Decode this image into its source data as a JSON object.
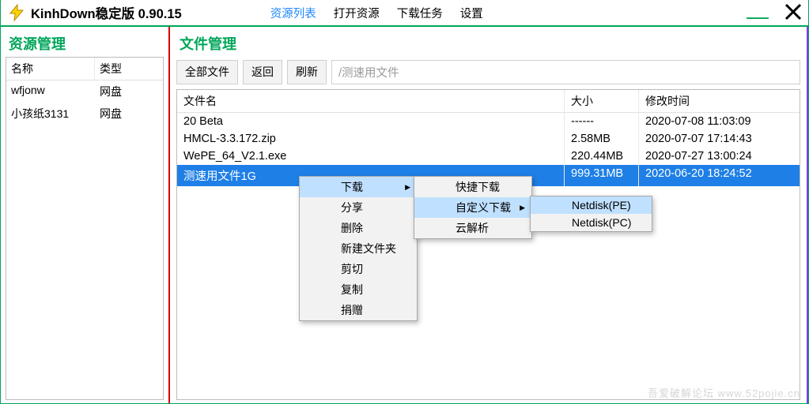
{
  "header": {
    "title": "KinhDown稳定版 0.90.15",
    "nav": [
      "资源列表",
      "打开资源",
      "下载任务",
      "设置"
    ],
    "active_index": 0
  },
  "sidebar": {
    "title": "资源管理",
    "head_name": "名称",
    "head_type": "类型",
    "rows": [
      {
        "name": "wfjonw",
        "type": "网盘"
      },
      {
        "name": "小孩纸3131",
        "type": "网盘"
      }
    ]
  },
  "main": {
    "title": "文件管理",
    "tb_all": "全部文件",
    "tb_back": "返回",
    "tb_refresh": "刷新",
    "path": "/测速用文件",
    "head_name": "文件名",
    "head_size": "大小",
    "head_time": "修改时间",
    "rows": [
      {
        "name": "20 Beta",
        "size": "------",
        "time": "2020-07-08 11:03:09",
        "sel": false
      },
      {
        "name": "HMCL-3.3.172.zip",
        "size": "2.58MB",
        "time": "2020-07-07 17:14:43",
        "sel": false
      },
      {
        "name": "WePE_64_V2.1.exe",
        "size": "220.44MB",
        "time": "2020-07-27 13:00:24",
        "sel": false
      },
      {
        "name": "测速用文件1G",
        "size": "999.31MB",
        "time": "2020-06-20 18:24:52",
        "sel": true
      }
    ]
  },
  "ctx": {
    "m1": [
      "下载",
      "分享",
      "删除",
      "新建文件夹",
      "剪切",
      "复制",
      "捐赠"
    ],
    "m1_hover": 0,
    "m2": [
      "快捷下载",
      "自定义下载",
      "云解析"
    ],
    "m2_hover": 1,
    "m3": [
      "Netdisk(PE)",
      "Netdisk(PC)"
    ],
    "m3_hover": 0
  },
  "watermark": "吾爱破解论坛 www.52pojie.cn"
}
